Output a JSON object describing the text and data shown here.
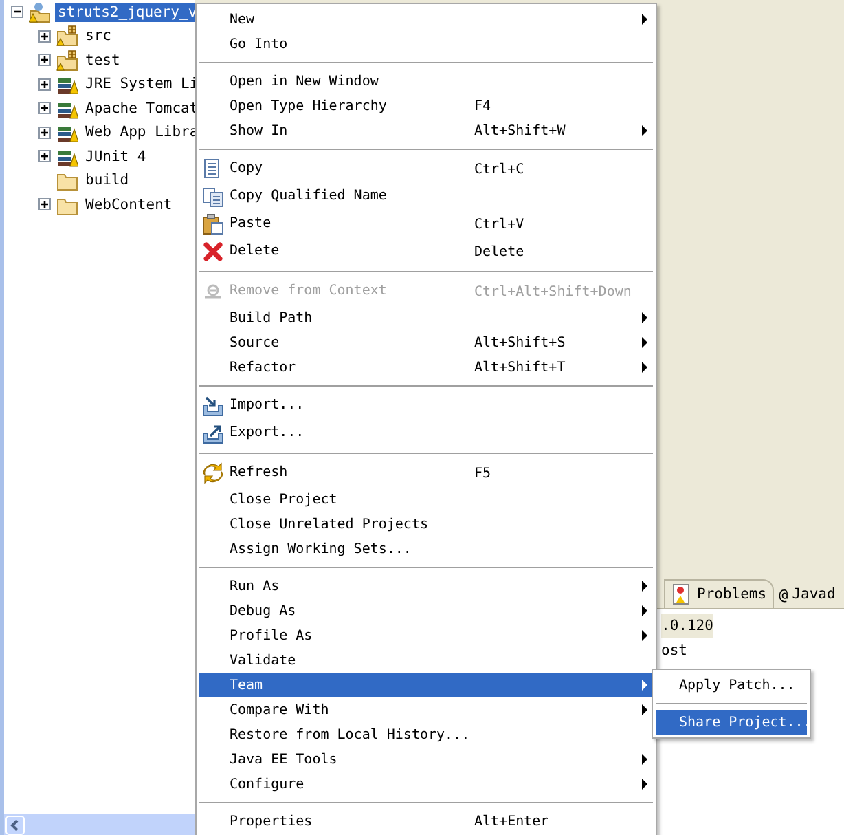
{
  "project_explorer": {
    "items": [
      {
        "label": "struts2_jquery_v",
        "kind": "project",
        "expanded": true,
        "selected": true,
        "children": [
          {
            "label": "src",
            "kind": "package",
            "expanded": false,
            "selected": false
          },
          {
            "label": "test",
            "kind": "package",
            "expanded": false,
            "selected": false
          },
          {
            "label": "JRE System Li",
            "kind": "library",
            "expanded": false,
            "selected": false
          },
          {
            "label": "Apache Tomcat",
            "kind": "library",
            "expanded": false,
            "selected": false
          },
          {
            "label": "Web App Libra",
            "kind": "library",
            "expanded": false,
            "selected": false
          },
          {
            "label": "JUnit 4",
            "kind": "library",
            "expanded": false,
            "selected": false
          },
          {
            "label": "build",
            "kind": "folder",
            "selected": false
          },
          {
            "label": "WebContent",
            "kind": "folder",
            "expanded": false,
            "selected": false
          }
        ]
      }
    ]
  },
  "context_menu": {
    "groups": [
      [
        {
          "label": "New",
          "submenu": true,
          "disabled": false,
          "selected": false
        },
        {
          "label": "Go Into",
          "submenu": false,
          "disabled": false,
          "selected": false
        }
      ],
      [
        {
          "label": "Open in New Window",
          "submenu": false,
          "disabled": false,
          "selected": false
        },
        {
          "label": "Open Type Hierarchy",
          "shortcut": "F4",
          "submenu": false,
          "disabled": false,
          "selected": false
        },
        {
          "label": "Show In",
          "shortcut": "Alt+Shift+W",
          "submenu": true,
          "disabled": false,
          "selected": false
        }
      ],
      [
        {
          "label": "Copy",
          "shortcut": "Ctrl+C",
          "kind": "copy",
          "submenu": false,
          "disabled": false,
          "selected": false
        },
        {
          "label": "Copy Qualified Name",
          "kind": "copy-qualified",
          "submenu": false,
          "disabled": false,
          "selected": false
        },
        {
          "label": "Paste",
          "shortcut": "Ctrl+V",
          "kind": "paste",
          "submenu": false,
          "disabled": false,
          "selected": false
        },
        {
          "label": "Delete",
          "shortcut": "Delete",
          "kind": "delete",
          "submenu": false,
          "disabled": false,
          "selected": false
        }
      ],
      [
        {
          "label": "Remove from Context",
          "shortcut": "Ctrl+Alt+Shift+Down",
          "kind": "remove",
          "submenu": false,
          "disabled": true,
          "selected": false
        },
        {
          "label": "Build Path",
          "submenu": true,
          "disabled": false,
          "selected": false
        },
        {
          "label": "Source",
          "shortcut": "Alt+Shift+S",
          "submenu": true,
          "disabled": false,
          "selected": false
        },
        {
          "label": "Refactor",
          "shortcut": "Alt+Shift+T",
          "submenu": true,
          "disabled": false,
          "selected": false
        }
      ],
      [
        {
          "label": "Import...",
          "kind": "import",
          "submenu": false,
          "disabled": false,
          "selected": false
        },
        {
          "label": "Export...",
          "kind": "export",
          "submenu": false,
          "disabled": false,
          "selected": false
        }
      ],
      [
        {
          "label": "Refresh",
          "shortcut": "F5",
          "kind": "refresh",
          "submenu": false,
          "disabled": false,
          "selected": false
        },
        {
          "label": "Close Project",
          "submenu": false,
          "disabled": false,
          "selected": false
        },
        {
          "label": "Close Unrelated Projects",
          "submenu": false,
          "disabled": false,
          "selected": false
        },
        {
          "label": "Assign Working Sets...",
          "submenu": false,
          "disabled": false,
          "selected": false
        }
      ],
      [
        {
          "label": "Run As",
          "submenu": true,
          "disabled": false,
          "selected": false
        },
        {
          "label": "Debug As",
          "submenu": true,
          "disabled": false,
          "selected": false
        },
        {
          "label": "Profile As",
          "submenu": true,
          "disabled": false,
          "selected": false
        },
        {
          "label": "Validate",
          "submenu": false,
          "disabled": false,
          "selected": false
        },
        {
          "label": "Team",
          "submenu": true,
          "disabled": false,
          "selected": true
        },
        {
          "label": "Compare With",
          "submenu": true,
          "disabled": false,
          "selected": false
        },
        {
          "label": "Restore from Local History...",
          "submenu": false,
          "disabled": false,
          "selected": false
        },
        {
          "label": "Java EE Tools",
          "submenu": true,
          "disabled": false,
          "selected": false
        },
        {
          "label": "Configure",
          "submenu": true,
          "disabled": false,
          "selected": false
        }
      ],
      [
        {
          "label": "Properties",
          "shortcut": "Alt+Enter",
          "submenu": false,
          "disabled": false,
          "selected": false
        }
      ]
    ]
  },
  "team_submenu": {
    "groups": [
      [
        {
          "label": "Apply Patch...",
          "selected": false
        }
      ],
      [
        {
          "label": "Share Project...",
          "selected": true
        }
      ]
    ]
  },
  "bottom_panel": {
    "tabs": [
      {
        "label": "Problems",
        "kind": "problems"
      },
      {
        "label": "Javad",
        "kind": "at",
        "glyph": "@"
      }
    ],
    "lines": [
      {
        "text": ".0.120",
        "highlighted": true
      },
      {
        "text": "ost",
        "highlighted": false
      }
    ]
  }
}
